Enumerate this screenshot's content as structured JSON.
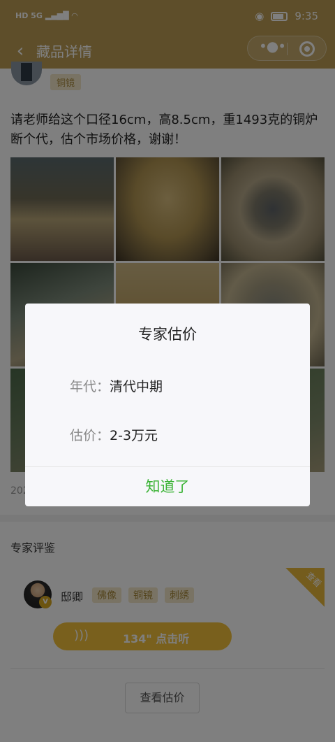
{
  "status_bar": {
    "network": "HD 5G",
    "time": "9:35"
  },
  "header": {
    "title": "藏品详情"
  },
  "post": {
    "tag": "铜镜",
    "question": "请老师给这个口径16cm，高8.5cm，重1493克的铜炉断个代，估个市场价格，谢谢！",
    "date_partial": "202"
  },
  "expert_section": {
    "title": "专家评鉴",
    "expert": {
      "name": "邸卿",
      "tags": [
        "佛像",
        "铜镜",
        "刺绣"
      ],
      "badge": "V",
      "corner_label": "查看"
    },
    "listen_button": "134\" 点击听",
    "view_estimate_button": "查看估价"
  },
  "modal": {
    "title": "专家估价",
    "rows": [
      {
        "label": "年代：",
        "value": "清代中期"
      },
      {
        "label": "估价：",
        "value": "2-3万元"
      }
    ],
    "confirm": "知道了"
  }
}
